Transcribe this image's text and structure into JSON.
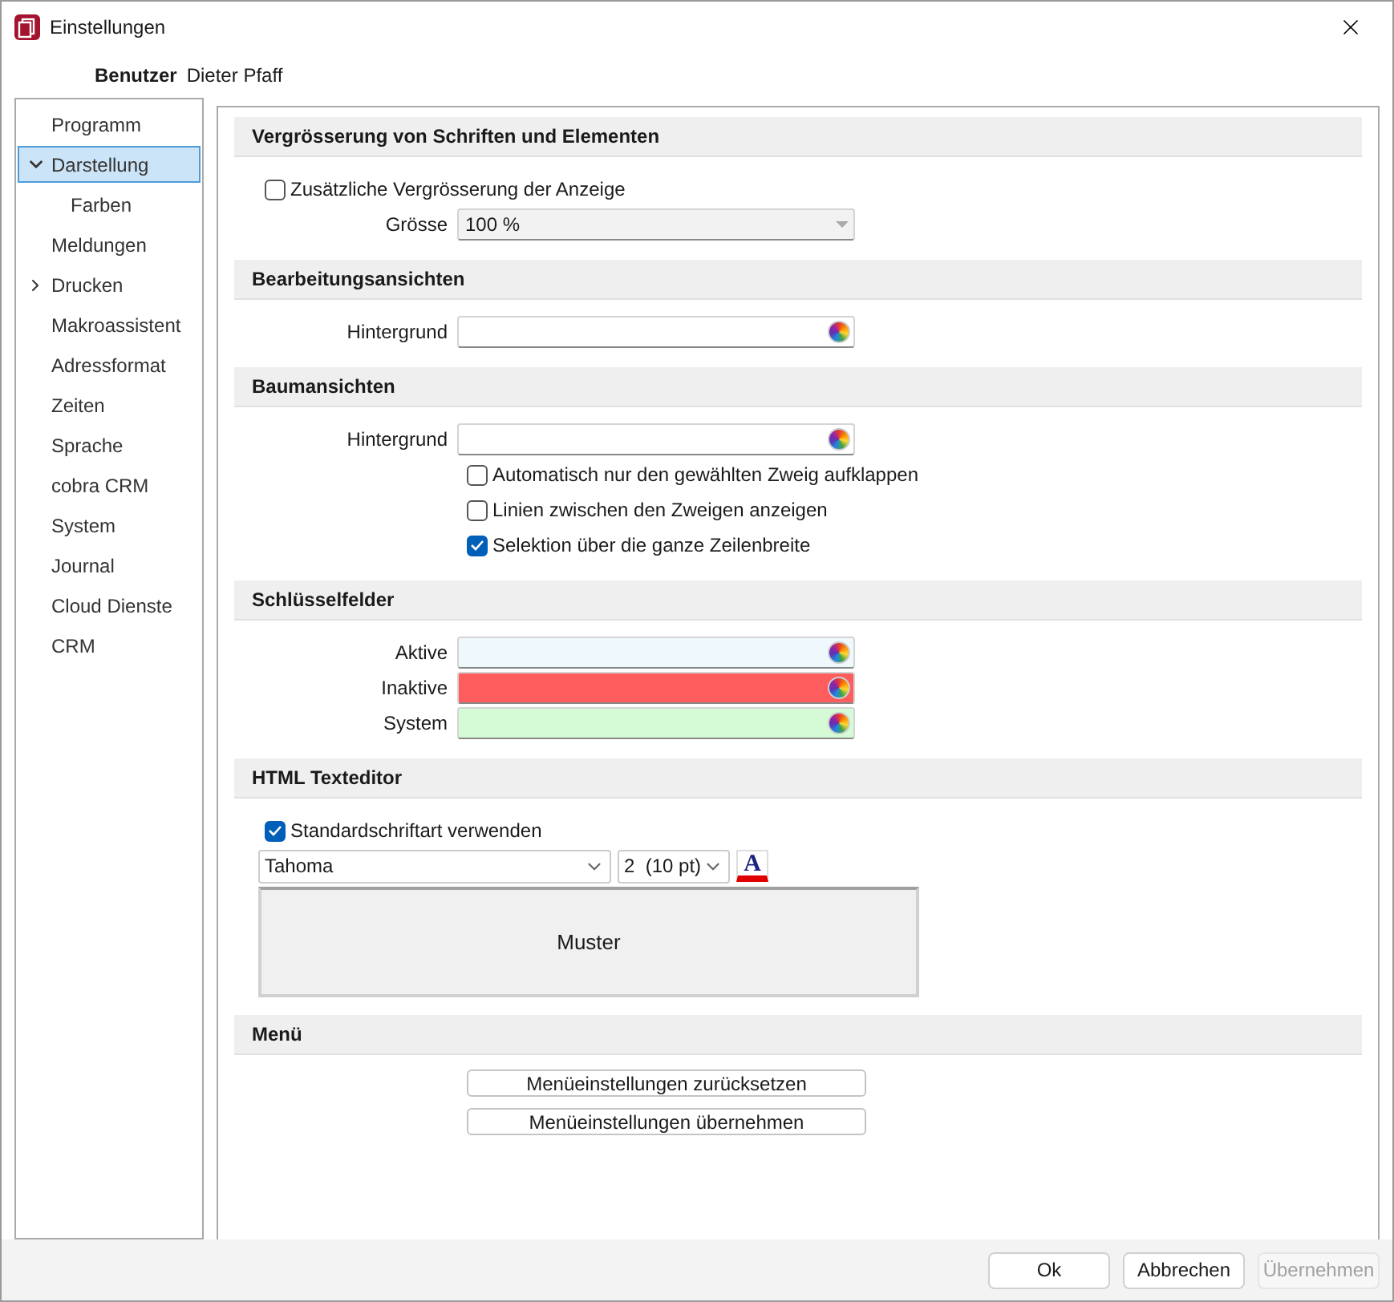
{
  "window": {
    "title": "Einstellungen"
  },
  "user": {
    "label": "Benutzer",
    "name": "Dieter Pfaff"
  },
  "sidebar": {
    "items": [
      {
        "label": "Programm",
        "selected": false
      },
      {
        "label": "Darstellung",
        "selected": true,
        "expanded": true,
        "children": [
          {
            "label": "Farben",
            "selected": false
          }
        ]
      },
      {
        "label": "Meldungen",
        "selected": false
      },
      {
        "label": "Drucken",
        "selected": false,
        "expanded": false
      },
      {
        "label": "Makroassistent",
        "selected": false
      },
      {
        "label": "Adressformat",
        "selected": false
      },
      {
        "label": "Zeiten",
        "selected": false
      },
      {
        "label": "Sprache",
        "selected": false
      },
      {
        "label": "cobra CRM",
        "selected": false
      },
      {
        "label": "System",
        "selected": false
      },
      {
        "label": "Journal",
        "selected": false
      },
      {
        "label": "Cloud Dienste",
        "selected": false
      },
      {
        "label": "CRM",
        "selected": false
      }
    ]
  },
  "sections": [
    {
      "title": "Vergrösserung von Schriften und Elementen",
      "rows": [
        {
          "kind": "checkbox",
          "label": "Zusätzliche Vergrösserung der Anzeige",
          "checked": false
        },
        {
          "kind": "select",
          "label": "Grösse",
          "value": "100 %",
          "disabled": true
        }
      ]
    },
    {
      "title": "Bearbeitungsansichten",
      "rows": [
        {
          "kind": "color",
          "label": "Hintergrund"
        }
      ]
    },
    {
      "title": "Baumansichten",
      "rows": [
        {
          "kind": "color",
          "label": "Hintergrund"
        },
        {
          "kind": "option",
          "label": "Automatisch nur den gewählten Zweig aufklappen",
          "checked": false
        },
        {
          "kind": "option",
          "label": "Linien zwischen den Zweigen anzeigen",
          "checked": false
        },
        {
          "kind": "option",
          "label": "Selektion über die ganze Zeilenbreite",
          "checked": true
        }
      ]
    },
    {
      "title": "Schlüsselfelder",
      "rows": [
        {
          "kind": "color",
          "label": "Aktive",
          "color": "#eff8fd"
        },
        {
          "kind": "color",
          "label": "Inaktive",
          "color": "#ff5d5d"
        },
        {
          "kind": "color",
          "label": "System",
          "color": "#d5fbd6"
        }
      ]
    },
    {
      "title": "HTML Texteditor",
      "rows": [
        {
          "kind": "checkbox",
          "label": "Standardschriftart verwenden",
          "checked": true
        },
        {
          "kind": "font",
          "font": "Tahoma",
          "size": "2  (10 pt)",
          "color_button": "A"
        },
        {
          "kind": "preview",
          "text": "Muster"
        }
      ]
    },
    {
      "title": "Menü",
      "rows": [
        {
          "kind": "button",
          "label": "Menüeinstellungen zurücksetzen"
        },
        {
          "kind": "button",
          "label": "Menüeinstellungen übernehmen"
        }
      ]
    }
  ],
  "buttons": [
    {
      "label": "Ok",
      "disabled": false
    },
    {
      "label": "Abbrechen",
      "disabled": false
    },
    {
      "label": "Übernehmen",
      "disabled": true
    }
  ]
}
